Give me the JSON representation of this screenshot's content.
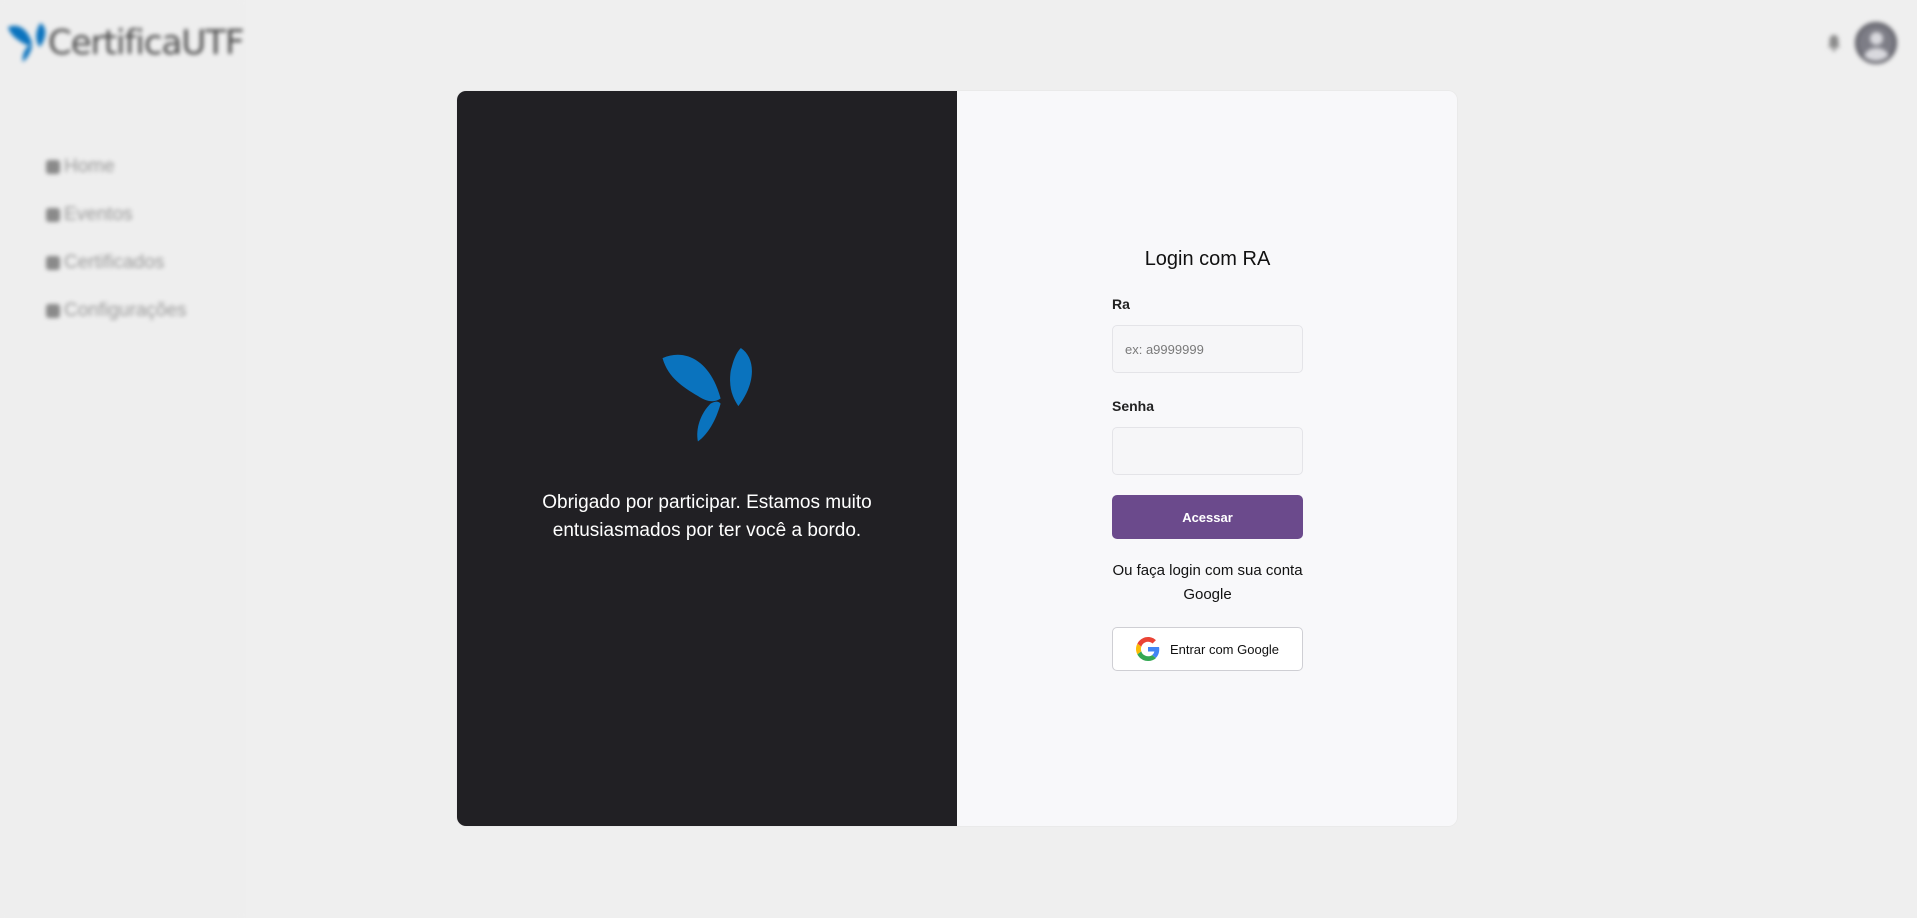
{
  "app": {
    "brand_name": "CertificaUTF",
    "brand_color": "#0a73be"
  },
  "sidebar": {
    "items": [
      {
        "label": "Home",
        "icon": "home-icon"
      },
      {
        "label": "Eventos",
        "icon": "calendar-icon"
      },
      {
        "label": "Certificados",
        "icon": "certificate-icon"
      },
      {
        "label": "Configurações",
        "icon": "settings-icon"
      }
    ]
  },
  "topbar": {
    "notification_icon": "bell-icon",
    "avatar_icon": "user-avatar-icon"
  },
  "login": {
    "welcome_text": "Obrigado por participar. Estamos muito entusiasmados por ter você a bordo.",
    "title": "Login com RA",
    "ra_label": "Ra",
    "ra_placeholder": "ex: a9999999",
    "ra_value": "",
    "password_label": "Senha",
    "password_value": "",
    "submit_label": "Acessar",
    "alt_login_text": "Ou faça login com sua conta Google",
    "google_button_label": "Entrar com Google"
  },
  "colors": {
    "left_panel": "#212024",
    "right_panel": "#f8f8fa",
    "primary_button": "#6b4a8c",
    "logo_blue": "#0a73be"
  }
}
